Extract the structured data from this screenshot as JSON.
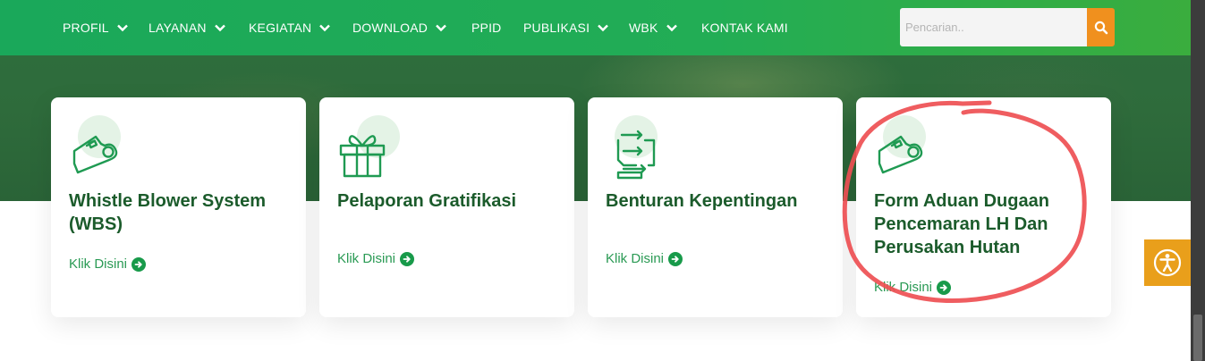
{
  "nav": {
    "items": [
      {
        "label": "PROFIL",
        "dropdown": true
      },
      {
        "label": "LAYANAN",
        "dropdown": true
      },
      {
        "label": "KEGIATAN",
        "dropdown": true
      },
      {
        "label": "DOWNLOAD",
        "dropdown": true
      },
      {
        "label": "PPID",
        "dropdown": false
      },
      {
        "label": "PUBLIKASI",
        "dropdown": true
      },
      {
        "label": "WBK",
        "dropdown": true
      },
      {
        "label": "KONTAK KAMI",
        "dropdown": false
      }
    ]
  },
  "search": {
    "placeholder": "Pencarian..",
    "value": "",
    "icon": "search-icon"
  },
  "cards": [
    {
      "title": "Whistle Blower System (WBS)",
      "link": "Klik Disini",
      "icon": "whistle-icon"
    },
    {
      "title": "Pelaporan Gratifikasi",
      "link": "Klik Disini",
      "icon": "gift-icon"
    },
    {
      "title": "Benturan Kepentingan",
      "link": "Klik Disini",
      "icon": "conflict-arrows-icon"
    },
    {
      "title": "Form Aduan Dugaan Pencemaran LH Dan Perusakan Hutan",
      "link": "Klik Disini",
      "icon": "whistle-icon"
    }
  ],
  "accessibility": {
    "icon": "accessibility-icon"
  },
  "colors": {
    "nav_green": "#1aa85a",
    "title_green": "#1b5b2b",
    "link_green": "#2a9a54",
    "search_orange": "#f0901e",
    "accessibility_orange": "#e99f1b",
    "annotation_red": "#ee4f53"
  }
}
